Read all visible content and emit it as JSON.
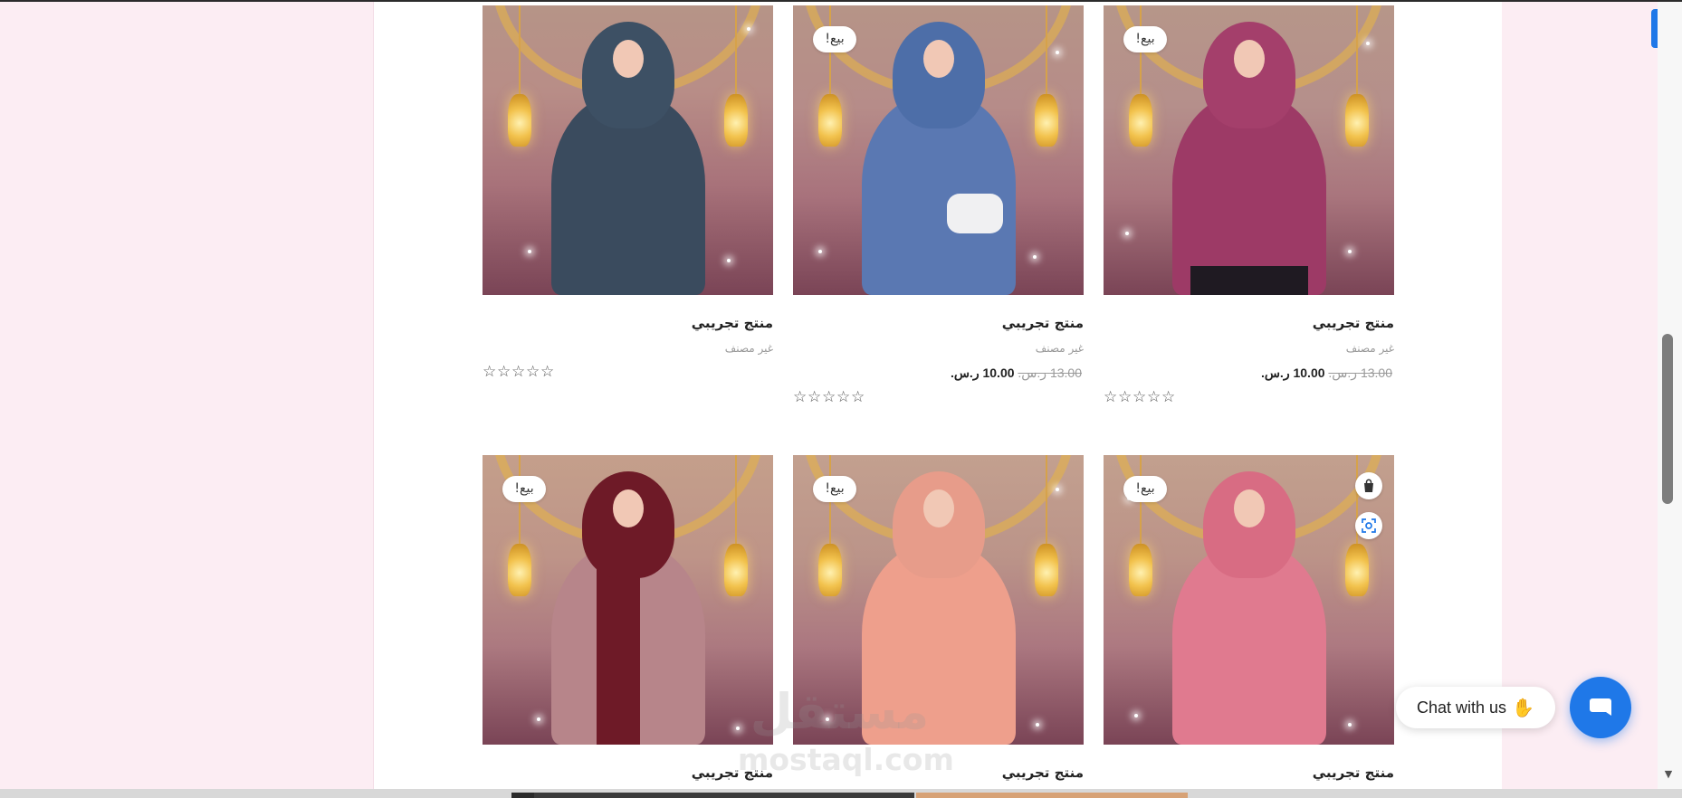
{
  "products": [
    {
      "title": "منتج تجريبي",
      "category": "غير مصنف",
      "sale_badge": "",
      "old_price": "",
      "new_price": "",
      "currency": "",
      "rating_stars": "☆☆☆☆☆",
      "hijab_color": "#3d5064",
      "dress_color": "#3a4b5e"
    },
    {
      "title": "منتج تجريبي",
      "category": "غير مصنف",
      "sale_badge": "بيع!",
      "old_price": "13.00",
      "old_currency": "ر.س.",
      "new_price": "10.00",
      "currency": "ر.س.",
      "rating_stars": "☆☆☆☆☆",
      "hijab_color": "#4d6ea8",
      "dress_color": "#5a78b2"
    },
    {
      "title": "منتج تجريبي",
      "category": "غير مصنف",
      "sale_badge": "بيع!",
      "old_price": "13.00",
      "old_currency": "ر.س.",
      "new_price": "10.00",
      "currency": "ر.س.",
      "rating_stars": "☆☆☆☆☆",
      "hijab_color": "#a43f6b",
      "dress_color": "#9d3a66"
    },
    {
      "title": "منتج تجريبي",
      "category": "",
      "sale_badge": "بيع!",
      "old_price": "",
      "new_price": "",
      "currency": "",
      "rating_stars": "",
      "hijab_color": "#6e1a27",
      "dress_color": "#b7858a"
    },
    {
      "title": "منتج تجريبي",
      "category": "",
      "sale_badge": "بيع!",
      "old_price": "",
      "new_price": "",
      "currency": "",
      "rating_stars": "",
      "hijab_color": "#e79c8a",
      "dress_color": "#ee9f8c"
    },
    {
      "title": "منتج تجريبي",
      "category": "",
      "sale_badge": "بيع!",
      "old_price": "",
      "new_price": "",
      "currency": "",
      "rating_stars": "",
      "hijab_color": "#d86c83",
      "dress_color": "#e07a8f"
    }
  ],
  "watermark": {
    "arabic": "مستقل",
    "english": "mostaql.com"
  },
  "chat": {
    "label": "Chat with us",
    "wave_icon": "waving-hand-icon",
    "button_icon": "chat-icon",
    "accent": "#1f78e8"
  },
  "colors": {
    "side_panel": "#fcedf3",
    "accent": "#1f78e8",
    "gold": "#e2b04d"
  }
}
